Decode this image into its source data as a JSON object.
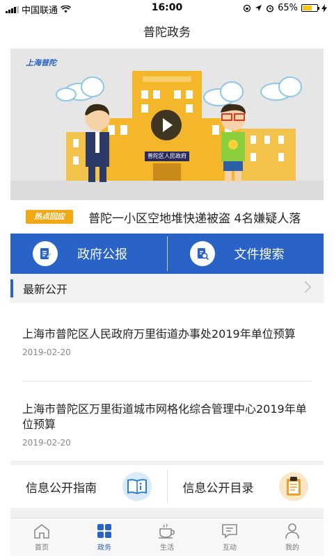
{
  "status_bar": {
    "carrier": "中国联通",
    "time": "16:00",
    "battery": "65%",
    "battery_level": 0.65
  },
  "nav": {
    "title": "普陀政务"
  },
  "banner": {
    "logo_text": "上海普陀",
    "building_sign": "普陀区人民政府"
  },
  "hot_news": {
    "badge": "热点回应",
    "text": "普陀一小区空地堆快递被盗 4名嫌疑人落"
  },
  "quick_actions": [
    {
      "label": "政府公报",
      "icon": "bulletin-icon"
    },
    {
      "label": "文件搜索",
      "icon": "document-search-icon"
    }
  ],
  "section": {
    "title": "最新公开"
  },
  "news": [
    {
      "title": "上海市普陀区人民政府万里街道办事处2019年单位预算",
      "date": "2019-02-20"
    },
    {
      "title": "上海市普陀区万里街道城市网格化综合管理中心2019年单位预算",
      "date": "2019-02-20"
    }
  ],
  "info_cards": [
    {
      "label": "信息公开指南",
      "icon": "guide-book-icon",
      "color": "#2a7fd4"
    },
    {
      "label": "信息公开目录",
      "icon": "clipboard-icon",
      "color": "#e8a030"
    }
  ],
  "tabs": [
    {
      "label": "首页",
      "icon": "home-icon",
      "active": false
    },
    {
      "label": "政务",
      "icon": "grid-icon",
      "active": true
    },
    {
      "label": "生活",
      "icon": "coffee-cup-icon",
      "active": false
    },
    {
      "label": "互动",
      "icon": "chat-icon",
      "active": false
    },
    {
      "label": "我的",
      "icon": "user-icon",
      "active": false
    }
  ],
  "colors": {
    "primary": "#2a63c8",
    "badge": "#f0a814"
  }
}
